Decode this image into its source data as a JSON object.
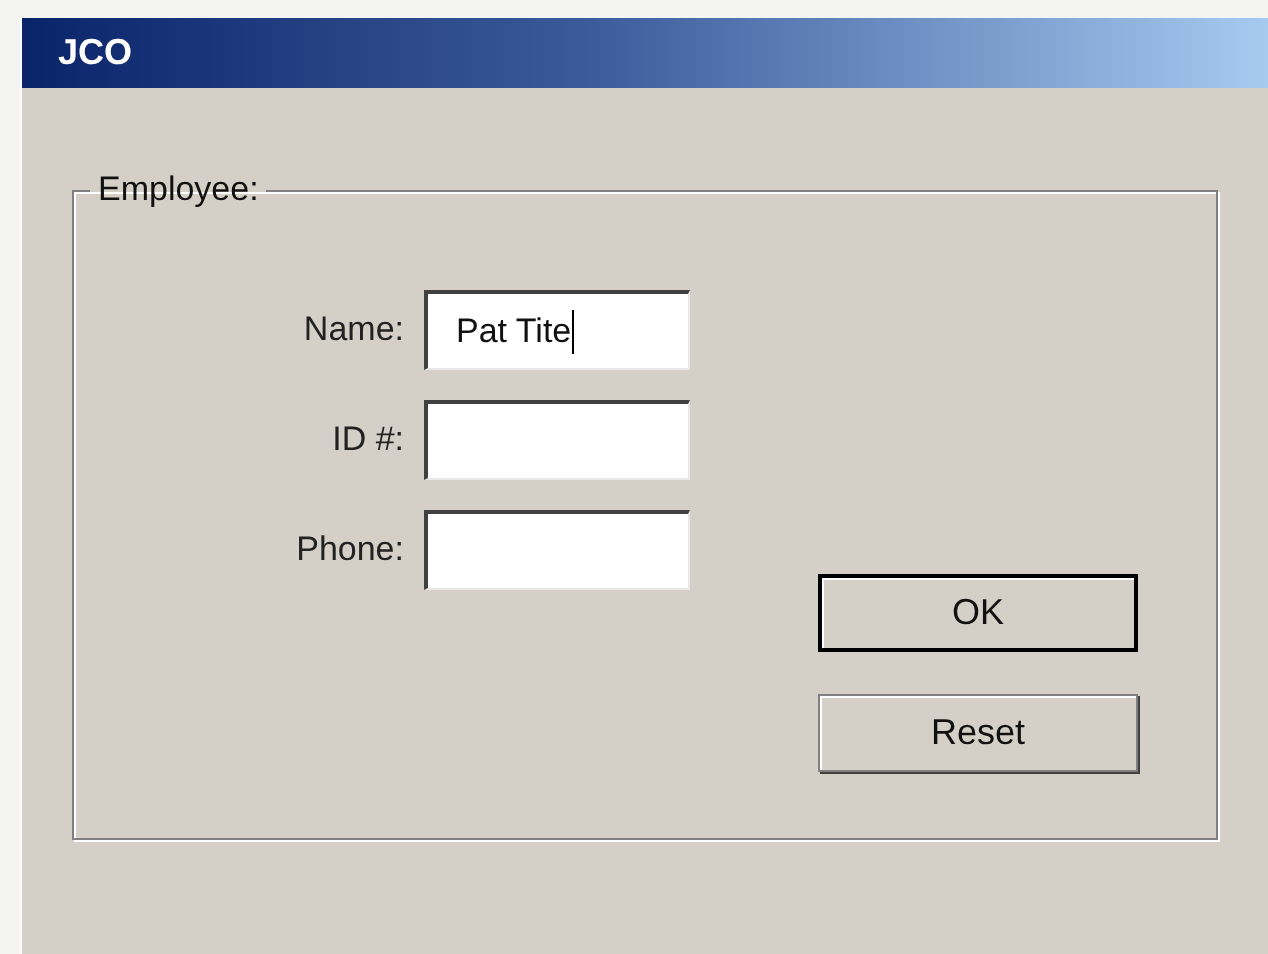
{
  "window": {
    "title": "JCO"
  },
  "group": {
    "label": "Employee:"
  },
  "fields": [
    {
      "label": "Name:",
      "value": "Pat Tite",
      "focused": true
    },
    {
      "label": "ID #:",
      "focused": false
    },
    {
      "label": "Phone:",
      "focused": false
    }
  ],
  "buttons": [
    {
      "label": "OK",
      "default": true
    },
    {
      "label": "Reset",
      "default": false
    }
  ]
}
